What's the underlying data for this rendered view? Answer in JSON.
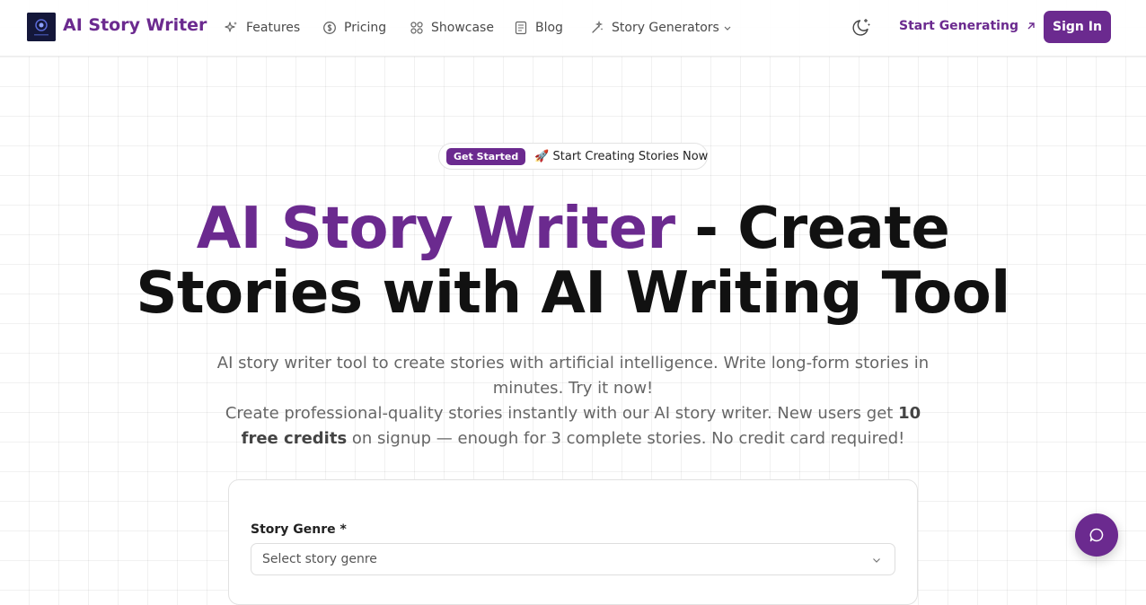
{
  "header": {
    "brand": "AI Story Writer",
    "nav": [
      {
        "label": "Features",
        "icon": "sparkles-icon"
      },
      {
        "label": "Pricing",
        "icon": "coin-icon"
      },
      {
        "label": "Showcase",
        "icon": "grid-icon"
      },
      {
        "label": "Blog",
        "icon": "document-icon"
      },
      {
        "label": "Story Generators",
        "icon": "magic-wand-icon",
        "has_dropdown": true
      }
    ],
    "start_generating": "Start Generating",
    "sign_in": "Sign In"
  },
  "hero": {
    "badge": "Get Started",
    "pill_text": "🚀 Start Creating Stories Now",
    "title_accent": "AI Story Writer",
    "title_rest_line1": " - Create",
    "title_line2": "Stories with AI Writing Tool",
    "subtitle_line1": "AI story writer tool to create stories with artificial intelligence. Write long-form stories in minutes. Try it now!",
    "subtitle_line2_pre": "Create professional-quality stories instantly with our AI story writer. New users get",
    "subtitle_bold": "10 free credits",
    "subtitle_line2_post": " on signup — enough for 3 complete stories. No credit card required!"
  },
  "form": {
    "genre_label": "Story Genre *",
    "genre_placeholder": "Select story genre"
  },
  "colors": {
    "accent": "#6b2a8f",
    "text": "#111111",
    "muted": "#666666"
  }
}
